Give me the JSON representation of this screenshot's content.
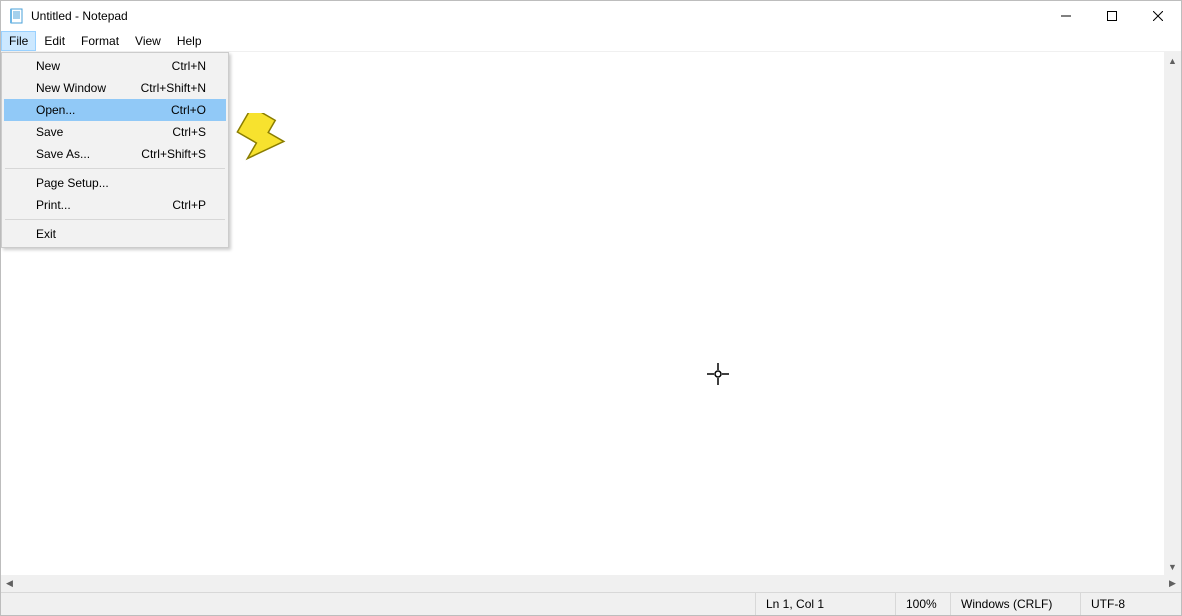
{
  "title": "Untitled - Notepad",
  "menus": {
    "file": "File",
    "edit": "Edit",
    "format": "Format",
    "view": "View",
    "help": "Help"
  },
  "file_menu": {
    "new": {
      "label": "New",
      "shortcut": "Ctrl+N"
    },
    "new_window": {
      "label": "New Window",
      "shortcut": "Ctrl+Shift+N"
    },
    "open": {
      "label": "Open...",
      "shortcut": "Ctrl+O"
    },
    "save": {
      "label": "Save",
      "shortcut": "Ctrl+S"
    },
    "save_as": {
      "label": "Save As...",
      "shortcut": "Ctrl+Shift+S"
    },
    "page_setup": {
      "label": "Page Setup...",
      "shortcut": ""
    },
    "print": {
      "label": "Print...",
      "shortcut": "Ctrl+P"
    },
    "exit": {
      "label": "Exit",
      "shortcut": ""
    }
  },
  "editor": {
    "value": ""
  },
  "status": {
    "position": "Ln 1, Col 1",
    "zoom": "100%",
    "line_ending": "Windows (CRLF)",
    "encoding": "UTF-8"
  }
}
